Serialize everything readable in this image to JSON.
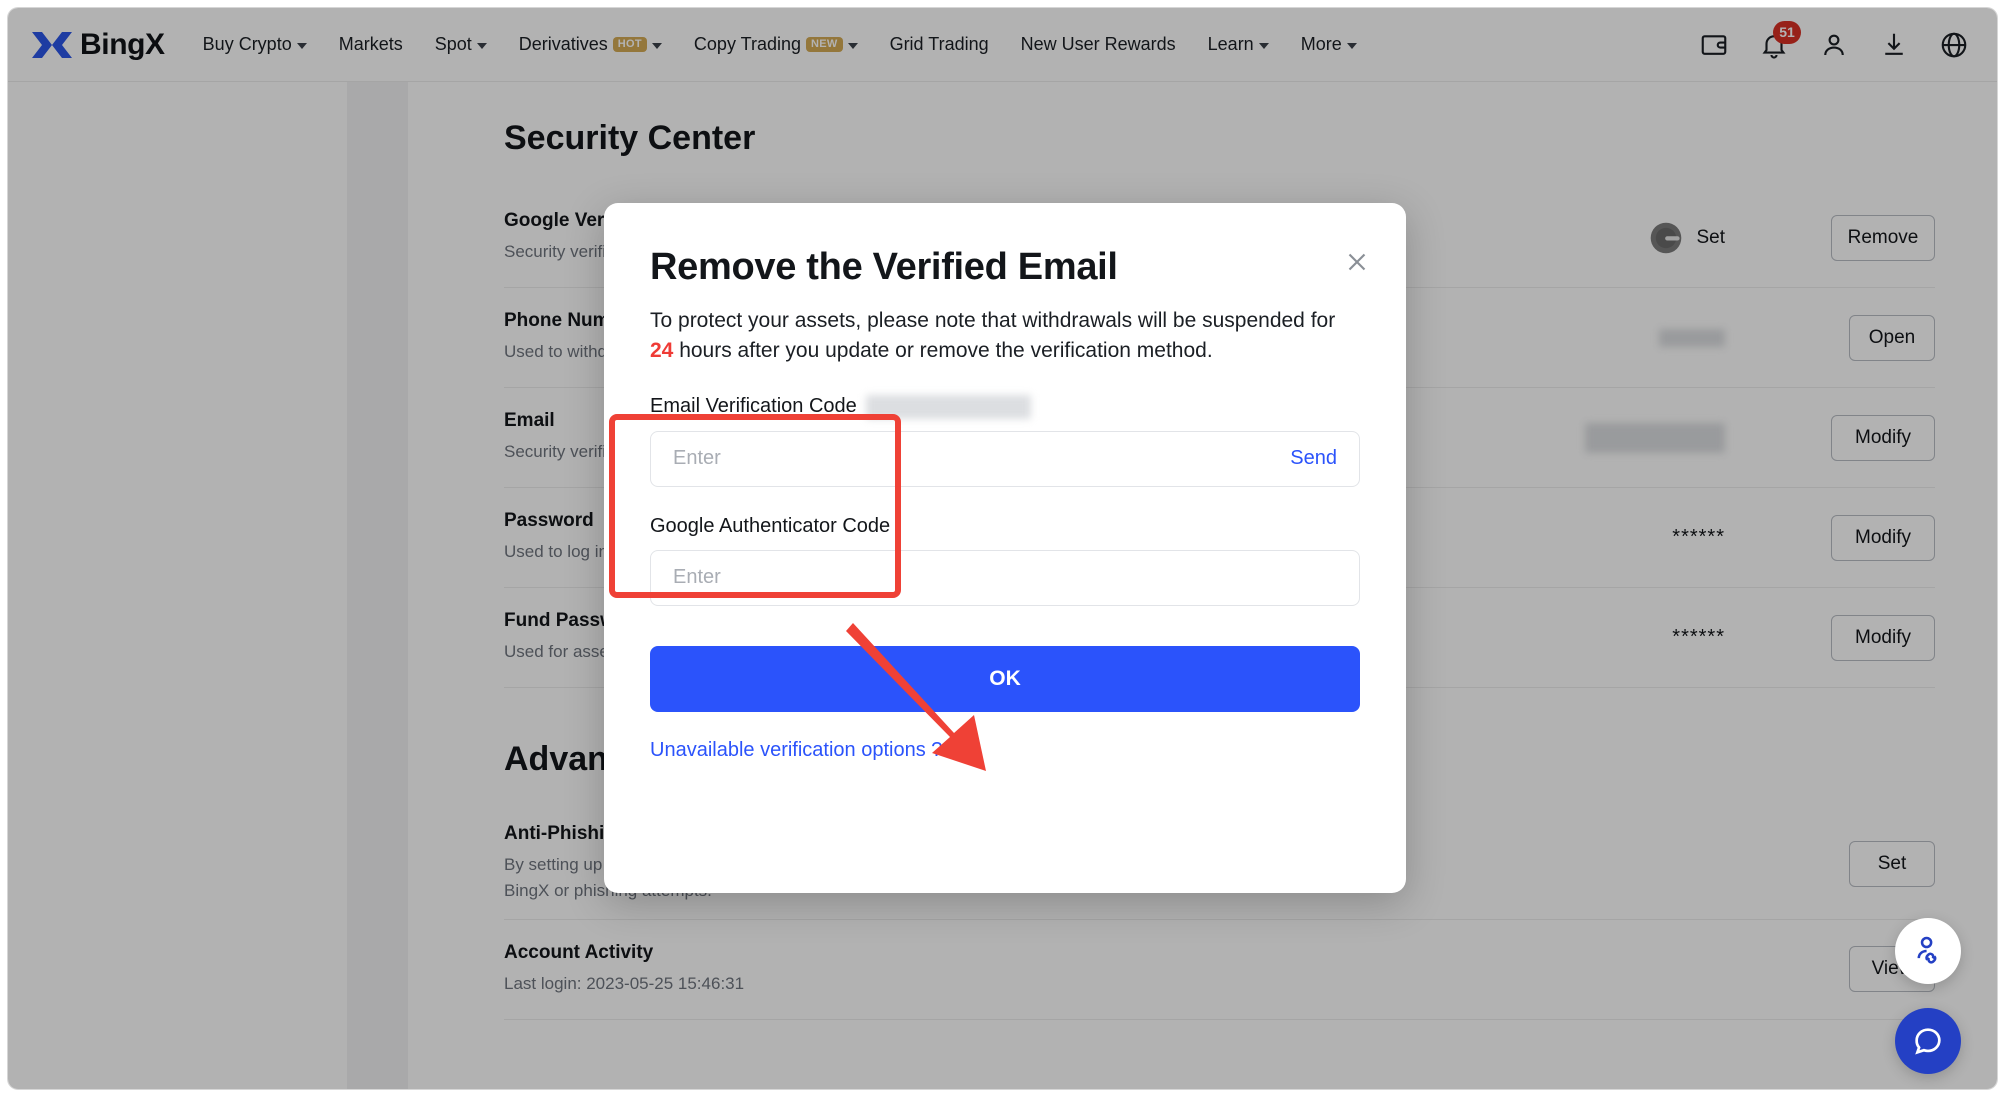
{
  "navbar": {
    "brand": "BingX",
    "links": [
      {
        "label": "Buy Crypto",
        "caret": true,
        "tag": null
      },
      {
        "label": "Markets",
        "caret": false,
        "tag": null
      },
      {
        "label": "Spot",
        "caret": true,
        "tag": null
      },
      {
        "label": "Derivatives",
        "caret": true,
        "tag": "HOT"
      },
      {
        "label": "Copy Trading",
        "caret": true,
        "tag": "NEW"
      },
      {
        "label": "Grid Trading",
        "caret": false,
        "tag": null
      },
      {
        "label": "New User Rewards",
        "caret": false,
        "tag": null
      },
      {
        "label": "Learn",
        "caret": true,
        "tag": null
      },
      {
        "label": "More",
        "caret": true,
        "tag": null
      }
    ],
    "icons": [
      {
        "name": "wallet-icon"
      },
      {
        "name": "bell-icon",
        "badge": "51"
      },
      {
        "name": "user-icon"
      },
      {
        "name": "download-icon"
      },
      {
        "name": "globe-icon"
      }
    ]
  },
  "page": {
    "security_title": "Security Center",
    "advanced_title": "Advanced",
    "security_rows": [
      {
        "title": "Google Verification",
        "desc": "Security verification",
        "value_type": "ga-set",
        "value": "Set",
        "action": "Remove"
      },
      {
        "title": "Phone Number",
        "desc": "Used to withdraw",
        "value_type": "masked",
        "value": "",
        "action": "Open"
      },
      {
        "title": "Email",
        "desc": "Security verification",
        "value_type": "masked",
        "value": "",
        "action": "Modify"
      },
      {
        "title": "Password",
        "desc": "Used to log in",
        "value_type": "stars",
        "value": "******",
        "action": "Modify"
      },
      {
        "title": "Fund Password",
        "desc": "Used for asset",
        "value_type": "stars",
        "value": "******",
        "action": "Modify"
      }
    ],
    "advanced_rows": [
      {
        "title": "Anti-Phishing Code",
        "desc": "By setting up an anti-phishing code, you will be able to know if the emails are from BingX or phishing attempts.",
        "action": "Set"
      },
      {
        "title": "Account Activity",
        "desc": "Last login: 2023-05-25 15:46:31",
        "action": "View"
      }
    ]
  },
  "modal": {
    "title": "Remove the Verified Email",
    "description_prefix": "To protect your assets, please note that withdrawals will be suspended for ",
    "description_highlight": "24",
    "description_suffix": " hours after you update or remove the verification method.",
    "email_field": {
      "label": "Email Verification Code",
      "masked_value": "",
      "placeholder": "Enter",
      "value": "",
      "send_label": "Send"
    },
    "ga_field": {
      "label": "Google Authenticator Code",
      "placeholder": "Enter",
      "value": ""
    },
    "ok_label": "OK",
    "unavailable_label": "Unavailable verification options ?",
    "close_icon": "close-icon"
  },
  "fabs": [
    {
      "name": "referral-fab",
      "icon": "person-link-icon"
    },
    {
      "name": "chat-fab",
      "icon": "chat-bubble-icon"
    }
  ],
  "colors": {
    "accent_blue": "#2B53FB",
    "annotation_red": "#EF4136",
    "badge_red": "#D93025",
    "tag_gold": "#D5AB55"
  }
}
